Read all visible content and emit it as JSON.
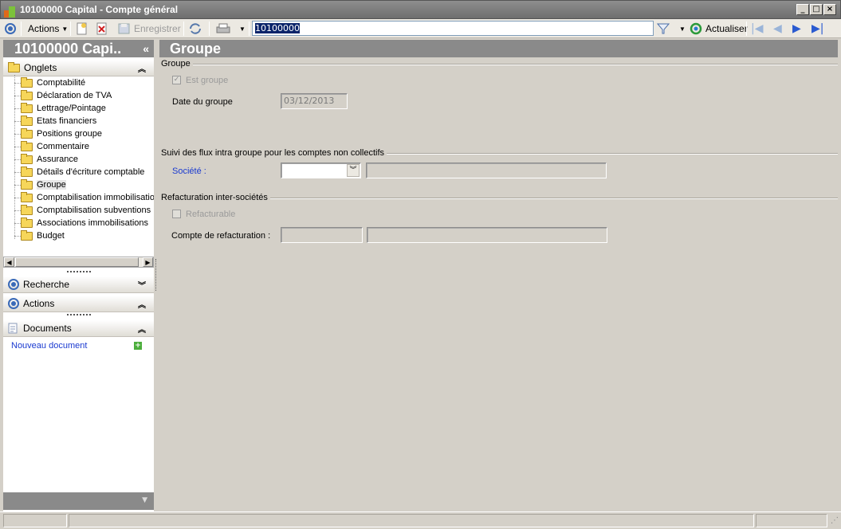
{
  "window": {
    "title": "10100000 Capital -  Compte général"
  },
  "toolbar": {
    "actions_label": "Actions",
    "save_label": "Enregistrer",
    "search_value": "10100000",
    "refresh_label": "Actualiser"
  },
  "sidebar": {
    "title": "10100000 Capi..",
    "collapse_glyph": "«",
    "tabs_header": "Onglets",
    "tabs": [
      {
        "label": "Comptabilité"
      },
      {
        "label": "Déclaration de TVA"
      },
      {
        "label": "Lettrage/Pointage"
      },
      {
        "label": "Etats financiers"
      },
      {
        "label": "Positions groupe"
      },
      {
        "label": "Commentaire"
      },
      {
        "label": "Assurance"
      },
      {
        "label": "Détails d'écriture comptable"
      },
      {
        "label": "Groupe"
      },
      {
        "label": "Comptabilisation immobilisations"
      },
      {
        "label": "Comptabilisation subventions"
      },
      {
        "label": "Associations immobilisations"
      },
      {
        "label": "Budget"
      }
    ],
    "selected_tab": "Groupe",
    "search_header": "Recherche",
    "actions_header": "Actions",
    "documents_header": "Documents",
    "new_document": "Nouveau document"
  },
  "main": {
    "title": "Groupe",
    "group_section": "Groupe",
    "is_group_label": "Est groupe",
    "is_group_checked": true,
    "group_date_label": "Date du groupe",
    "group_date_value": "03/12/2013",
    "intra_section": "Suivi des flux intra groupe pour les comptes non collectifs",
    "company_label": "Société :",
    "company_value": "",
    "refact_section": "Refacturation inter-sociétés",
    "refacturable_label": "Refacturable",
    "refacturable_checked": false,
    "refact_account_label": "Compte de refacturation :"
  },
  "colors": {
    "header_gray": "#8a8a8a",
    "link_blue": "#1a3ad0",
    "face": "#d4d0c8"
  }
}
